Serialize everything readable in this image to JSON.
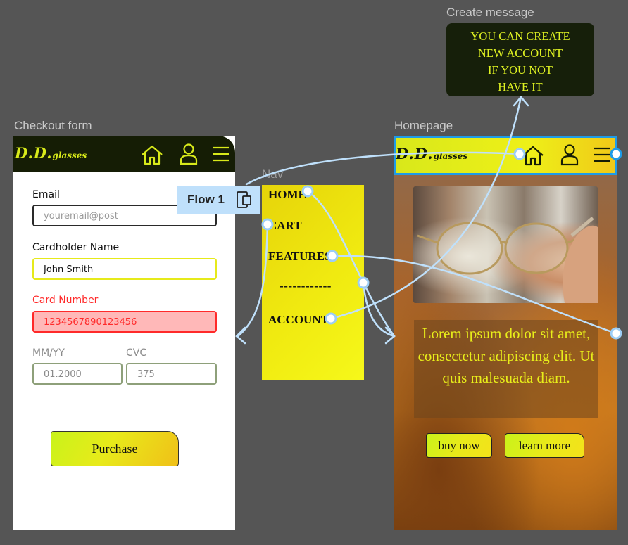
{
  "frames": {
    "checkout_label": "Checkout form",
    "nav_label": "Nav",
    "homepage_label": "Homepage",
    "message_label": "Create message"
  },
  "brand": {
    "logo_big": "D.D.",
    "logo_small": "glasses"
  },
  "checkout": {
    "email_label": "Email",
    "email_placeholder": "youremail@post",
    "cardholder_label": "Cardholder Name",
    "cardholder_value": "John Smith",
    "card_number_label": "Card Number",
    "card_number_value": "1234567890123456",
    "expiry_label": "MM/YY",
    "expiry_value": "01.2000",
    "cvc_label": "CVC",
    "cvc_value": "375",
    "purchase_label": "Purchase"
  },
  "nav": {
    "items": [
      "HOME",
      "CART",
      "FEATURES",
      "------------",
      "ACCOUNT"
    ]
  },
  "flow": {
    "label": "Flow 1"
  },
  "message": {
    "lines": [
      "YOU CAN CREATE",
      "NEW ACCOUNT",
      "IF YOU NOT",
      "HAVE IT"
    ]
  },
  "homepage": {
    "hero_text": "Lorem ipsum dolor sit amet, consectetur adipiscing elit. Ut quis malesuada diam.",
    "buy_label": "buy now",
    "learn_label": "learn more"
  },
  "colors": {
    "canvas": "#555555",
    "brand_yellow": "#e8ea1a",
    "dark_header": "#151d05",
    "error_red": "#ff2a2a",
    "error_fill": "#ffb8b8",
    "prototype_blue": "#bfe0fb",
    "selection_blue": "#1e9be8"
  }
}
